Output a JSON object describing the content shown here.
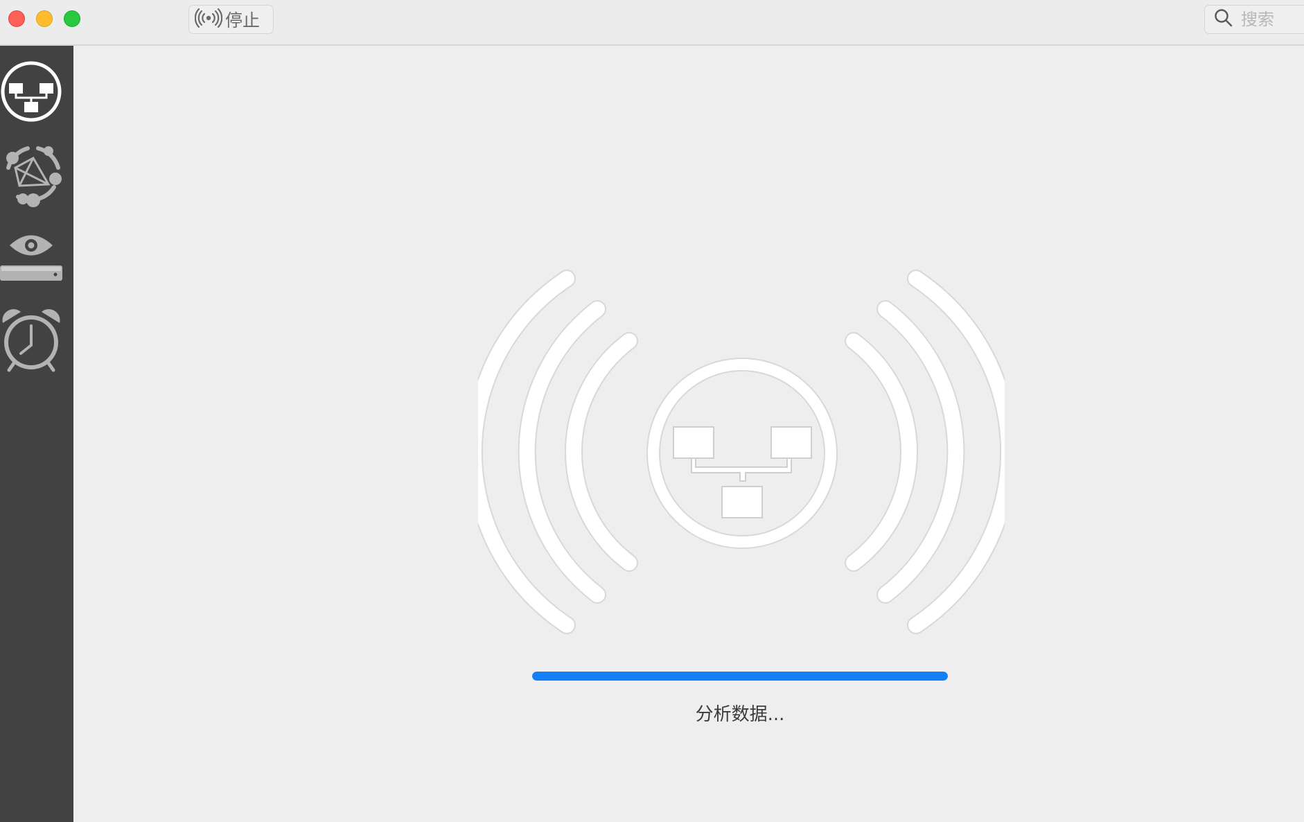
{
  "window": {
    "traffic_lights": [
      "close",
      "minimize",
      "zoom"
    ]
  },
  "toolbar": {
    "stop_icon": "broadcast-icon",
    "stop_label": "停止",
    "search_icon": "search-icon",
    "search_placeholder": "搜索",
    "search_value": ""
  },
  "sidebar": {
    "items": [
      {
        "icon": "network-icon",
        "selected": true
      },
      {
        "icon": "nodes-cluster-icon",
        "selected": false
      },
      {
        "icon": "eye-monitor-icon",
        "selected": false
      },
      {
        "icon": "alarm-clock-icon",
        "selected": false
      }
    ]
  },
  "main": {
    "hero_icon": "network-broadcast-icon",
    "progress": 1.0,
    "status_text": "分析数据..."
  },
  "colors": {
    "accent": "#1580f5",
    "sidebar_bg": "#424242",
    "content_bg": "#eeeeee"
  }
}
